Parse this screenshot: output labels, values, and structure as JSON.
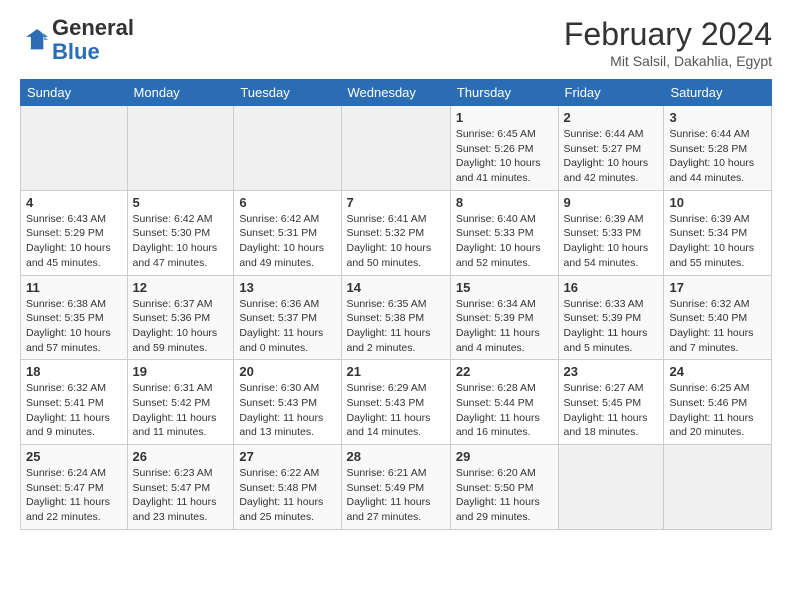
{
  "header": {
    "logo_general": "General",
    "logo_blue": "Blue",
    "month_title": "February 2024",
    "location": "Mit Salsil, Dakahlia, Egypt"
  },
  "days_of_week": [
    "Sunday",
    "Monday",
    "Tuesday",
    "Wednesday",
    "Thursday",
    "Friday",
    "Saturday"
  ],
  "weeks": [
    [
      {
        "day": "",
        "info": ""
      },
      {
        "day": "",
        "info": ""
      },
      {
        "day": "",
        "info": ""
      },
      {
        "day": "",
        "info": ""
      },
      {
        "day": "1",
        "info": "Sunrise: 6:45 AM\nSunset: 5:26 PM\nDaylight: 10 hours and 41 minutes."
      },
      {
        "day": "2",
        "info": "Sunrise: 6:44 AM\nSunset: 5:27 PM\nDaylight: 10 hours and 42 minutes."
      },
      {
        "day": "3",
        "info": "Sunrise: 6:44 AM\nSunset: 5:28 PM\nDaylight: 10 hours and 44 minutes."
      }
    ],
    [
      {
        "day": "4",
        "info": "Sunrise: 6:43 AM\nSunset: 5:29 PM\nDaylight: 10 hours and 45 minutes."
      },
      {
        "day": "5",
        "info": "Sunrise: 6:42 AM\nSunset: 5:30 PM\nDaylight: 10 hours and 47 minutes."
      },
      {
        "day": "6",
        "info": "Sunrise: 6:42 AM\nSunset: 5:31 PM\nDaylight: 10 hours and 49 minutes."
      },
      {
        "day": "7",
        "info": "Sunrise: 6:41 AM\nSunset: 5:32 PM\nDaylight: 10 hours and 50 minutes."
      },
      {
        "day": "8",
        "info": "Sunrise: 6:40 AM\nSunset: 5:33 PM\nDaylight: 10 hours and 52 minutes."
      },
      {
        "day": "9",
        "info": "Sunrise: 6:39 AM\nSunset: 5:33 PM\nDaylight: 10 hours and 54 minutes."
      },
      {
        "day": "10",
        "info": "Sunrise: 6:39 AM\nSunset: 5:34 PM\nDaylight: 10 hours and 55 minutes."
      }
    ],
    [
      {
        "day": "11",
        "info": "Sunrise: 6:38 AM\nSunset: 5:35 PM\nDaylight: 10 hours and 57 minutes."
      },
      {
        "day": "12",
        "info": "Sunrise: 6:37 AM\nSunset: 5:36 PM\nDaylight: 10 hours and 59 minutes."
      },
      {
        "day": "13",
        "info": "Sunrise: 6:36 AM\nSunset: 5:37 PM\nDaylight: 11 hours and 0 minutes."
      },
      {
        "day": "14",
        "info": "Sunrise: 6:35 AM\nSunset: 5:38 PM\nDaylight: 11 hours and 2 minutes."
      },
      {
        "day": "15",
        "info": "Sunrise: 6:34 AM\nSunset: 5:39 PM\nDaylight: 11 hours and 4 minutes."
      },
      {
        "day": "16",
        "info": "Sunrise: 6:33 AM\nSunset: 5:39 PM\nDaylight: 11 hours and 5 minutes."
      },
      {
        "day": "17",
        "info": "Sunrise: 6:32 AM\nSunset: 5:40 PM\nDaylight: 11 hours and 7 minutes."
      }
    ],
    [
      {
        "day": "18",
        "info": "Sunrise: 6:32 AM\nSunset: 5:41 PM\nDaylight: 11 hours and 9 minutes."
      },
      {
        "day": "19",
        "info": "Sunrise: 6:31 AM\nSunset: 5:42 PM\nDaylight: 11 hours and 11 minutes."
      },
      {
        "day": "20",
        "info": "Sunrise: 6:30 AM\nSunset: 5:43 PM\nDaylight: 11 hours and 13 minutes."
      },
      {
        "day": "21",
        "info": "Sunrise: 6:29 AM\nSunset: 5:43 PM\nDaylight: 11 hours and 14 minutes."
      },
      {
        "day": "22",
        "info": "Sunrise: 6:28 AM\nSunset: 5:44 PM\nDaylight: 11 hours and 16 minutes."
      },
      {
        "day": "23",
        "info": "Sunrise: 6:27 AM\nSunset: 5:45 PM\nDaylight: 11 hours and 18 minutes."
      },
      {
        "day": "24",
        "info": "Sunrise: 6:25 AM\nSunset: 5:46 PM\nDaylight: 11 hours and 20 minutes."
      }
    ],
    [
      {
        "day": "25",
        "info": "Sunrise: 6:24 AM\nSunset: 5:47 PM\nDaylight: 11 hours and 22 minutes."
      },
      {
        "day": "26",
        "info": "Sunrise: 6:23 AM\nSunset: 5:47 PM\nDaylight: 11 hours and 23 minutes."
      },
      {
        "day": "27",
        "info": "Sunrise: 6:22 AM\nSunset: 5:48 PM\nDaylight: 11 hours and 25 minutes."
      },
      {
        "day": "28",
        "info": "Sunrise: 6:21 AM\nSunset: 5:49 PM\nDaylight: 11 hours and 27 minutes."
      },
      {
        "day": "29",
        "info": "Sunrise: 6:20 AM\nSunset: 5:50 PM\nDaylight: 11 hours and 29 minutes."
      },
      {
        "day": "",
        "info": ""
      },
      {
        "day": "",
        "info": ""
      }
    ]
  ]
}
